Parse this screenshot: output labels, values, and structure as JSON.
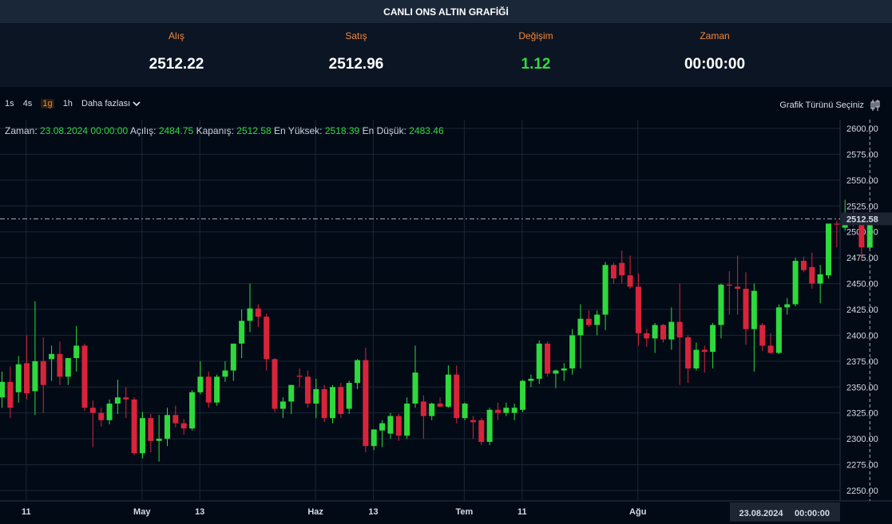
{
  "header": {
    "title": "CANLI ONS ALTIN GRAFİĞİ"
  },
  "stats": [
    {
      "label": "Alış",
      "value": "2512.22",
      "color": "#ffffff"
    },
    {
      "label": "Satış",
      "value": "2512.96",
      "color": "#ffffff"
    },
    {
      "label": "Değişim",
      "value": "1.12",
      "color": "#33d940"
    },
    {
      "label": "Zaman",
      "value": "00:00:00",
      "color": "#ffffff"
    }
  ],
  "toolbar": {
    "intervals": [
      "1s",
      "4s",
      "1g",
      "1h"
    ],
    "active_interval": "1g",
    "more_label": "Daha fazlası",
    "chart_type_label": "Grafik Türünü Seçiniz",
    "chart_type_icon": "candlestick-icon",
    "more_icon": "chevron-down-icon"
  },
  "ohlc_readout": {
    "time_label": "Zaman:",
    "time_value": "23.08.2024 00:00:00",
    "open_label": "Açılış:",
    "open_value": "2484.75",
    "close_label": "Kapanış:",
    "close_value": "2512.58",
    "high_label": "En Yüksek:",
    "high_value": "2518.39",
    "low_label": "En Düşük:",
    "low_value": "2483.46"
  },
  "crosshair": {
    "price_tag": "2512.58",
    "date_tag": "23.08.2024",
    "time_tag": "00:00:00"
  },
  "colors": {
    "up": "#2fd93c",
    "down": "#d8243b",
    "grid": "#1c2636",
    "crosshair": "#a8b2c0",
    "accent": "#f3883b"
  },
  "chart_data": {
    "type": "candlestick",
    "y_ticks": [
      2250,
      2275,
      2300,
      2325,
      2350,
      2375,
      2400,
      2425,
      2450,
      2475,
      2500,
      2525,
      2550,
      2575,
      2600
    ],
    "ylim": [
      2238,
      2608
    ],
    "x_ticks": [
      "11",
      "May",
      "13",
      "Haz",
      "13",
      "Tem",
      "11",
      "Ağu"
    ],
    "x_tick_index": [
      1,
      15,
      22,
      36,
      43,
      54,
      61,
      75
    ],
    "candles": [
      {
        "o": 2340,
        "h": 2365,
        "l": 2330,
        "c": 2355
      },
      {
        "o": 2355,
        "h": 2370,
        "l": 2320,
        "c": 2330
      },
      {
        "o": 2345,
        "h": 2380,
        "l": 2335,
        "c": 2372
      },
      {
        "o": 2373,
        "h": 2400,
        "l": 2338,
        "c": 2344
      },
      {
        "o": 2346,
        "h": 2433,
        "l": 2323,
        "c": 2375
      },
      {
        "o": 2375,
        "h": 2398,
        "l": 2325,
        "c": 2352
      },
      {
        "o": 2377,
        "h": 2390,
        "l": 2356,
        "c": 2382
      },
      {
        "o": 2382,
        "h": 2394,
        "l": 2352,
        "c": 2360
      },
      {
        "o": 2360,
        "h": 2375,
        "l": 2352,
        "c": 2378
      },
      {
        "o": 2378,
        "h": 2409,
        "l": 2365,
        "c": 2390
      },
      {
        "o": 2390,
        "h": 2392,
        "l": 2327,
        "c": 2330
      },
      {
        "o": 2330,
        "h": 2337,
        "l": 2292,
        "c": 2325
      },
      {
        "o": 2325,
        "h": 2330,
        "l": 2312,
        "c": 2318
      },
      {
        "o": 2318,
        "h": 2338,
        "l": 2314,
        "c": 2334
      },
      {
        "o": 2334,
        "h": 2357,
        "l": 2324,
        "c": 2340
      },
      {
        "o": 2340,
        "h": 2350,
        "l": 2320,
        "c": 2338
      },
      {
        "o": 2338,
        "h": 2340,
        "l": 2284,
        "c": 2286
      },
      {
        "o": 2286,
        "h": 2326,
        "l": 2281,
        "c": 2320
      },
      {
        "o": 2320,
        "h": 2324,
        "l": 2287,
        "c": 2298
      },
      {
        "o": 2298,
        "h": 2323,
        "l": 2278,
        "c": 2300
      },
      {
        "o": 2300,
        "h": 2330,
        "l": 2293,
        "c": 2323
      },
      {
        "o": 2323,
        "h": 2332,
        "l": 2311,
        "c": 2315
      },
      {
        "o": 2315,
        "h": 2319,
        "l": 2304,
        "c": 2310
      },
      {
        "o": 2310,
        "h": 2347,
        "l": 2308,
        "c": 2345
      },
      {
        "o": 2345,
        "h": 2375,
        "l": 2343,
        "c": 2360
      },
      {
        "o": 2360,
        "h": 2365,
        "l": 2330,
        "c": 2335
      },
      {
        "o": 2335,
        "h": 2362,
        "l": 2332,
        "c": 2360
      },
      {
        "o": 2360,
        "h": 2375,
        "l": 2355,
        "c": 2366
      },
      {
        "o": 2366,
        "h": 2386,
        "l": 2356,
        "c": 2392
      },
      {
        "o": 2392,
        "h": 2425,
        "l": 2378,
        "c": 2414
      },
      {
        "o": 2414,
        "h": 2450,
        "l": 2403,
        "c": 2426
      },
      {
        "o": 2426,
        "h": 2430,
        "l": 2408,
        "c": 2418
      },
      {
        "o": 2418,
        "h": 2421,
        "l": 2366,
        "c": 2377
      },
      {
        "o": 2377,
        "h": 2378,
        "l": 2326,
        "c": 2329
      },
      {
        "o": 2329,
        "h": 2340,
        "l": 2320,
        "c": 2336
      },
      {
        "o": 2336,
        "h": 2352,
        "l": 2324,
        "c": 2352
      },
      {
        "o": 2361,
        "h": 2368,
        "l": 2350,
        "c": 2360
      },
      {
        "o": 2360,
        "h": 2366,
        "l": 2330,
        "c": 2334
      },
      {
        "o": 2334,
        "h": 2358,
        "l": 2320,
        "c": 2348
      },
      {
        "o": 2348,
        "h": 2352,
        "l": 2316,
        "c": 2320
      },
      {
        "o": 2320,
        "h": 2352,
        "l": 2315,
        "c": 2350
      },
      {
        "o": 2350,
        "h": 2354,
        "l": 2320,
        "c": 2324
      },
      {
        "o": 2329,
        "h": 2356,
        "l": 2324,
        "c": 2354
      },
      {
        "o": 2354,
        "h": 2377,
        "l": 2348,
        "c": 2376
      },
      {
        "o": 2376,
        "h": 2388,
        "l": 2287,
        "c": 2293
      },
      {
        "o": 2293,
        "h": 2308,
        "l": 2289,
        "c": 2309
      },
      {
        "o": 2308,
        "h": 2318,
        "l": 2292,
        "c": 2315
      },
      {
        "o": 2305,
        "h": 2325,
        "l": 2300,
        "c": 2322
      },
      {
        "o": 2322,
        "h": 2324,
        "l": 2298,
        "c": 2303
      },
      {
        "o": 2303,
        "h": 2340,
        "l": 2300,
        "c": 2334
      },
      {
        "o": 2334,
        "h": 2390,
        "l": 2330,
        "c": 2364
      },
      {
        "o": 2336,
        "h": 2342,
        "l": 2300,
        "c": 2322
      },
      {
        "o": 2322,
        "h": 2335,
        "l": 2318,
        "c": 2334
      },
      {
        "o": 2334,
        "h": 2340,
        "l": 2332,
        "c": 2331
      },
      {
        "o": 2331,
        "h": 2371,
        "l": 2330,
        "c": 2362
      },
      {
        "o": 2362,
        "h": 2371,
        "l": 2315,
        "c": 2320
      },
      {
        "o": 2320,
        "h": 2335,
        "l": 2318,
        "c": 2334
      },
      {
        "o": 2318,
        "h": 2322,
        "l": 2300,
        "c": 2316
      },
      {
        "o": 2318,
        "h": 2320,
        "l": 2294,
        "c": 2297
      },
      {
        "o": 2297,
        "h": 2330,
        "l": 2294,
        "c": 2328
      },
      {
        "o": 2328,
        "h": 2335,
        "l": 2318,
        "c": 2325
      },
      {
        "o": 2325,
        "h": 2335,
        "l": 2322,
        "c": 2330
      },
      {
        "o": 2325,
        "h": 2334,
        "l": 2318,
        "c": 2330
      },
      {
        "o": 2328,
        "h": 2357,
        "l": 2326,
        "c": 2356
      },
      {
        "o": 2356,
        "h": 2362,
        "l": 2350,
        "c": 2358
      },
      {
        "o": 2358,
        "h": 2395,
        "l": 2353,
        "c": 2392
      },
      {
        "o": 2392,
        "h": 2394,
        "l": 2360,
        "c": 2363
      },
      {
        "o": 2363,
        "h": 2367,
        "l": 2349,
        "c": 2366
      },
      {
        "o": 2366,
        "h": 2373,
        "l": 2356,
        "c": 2368
      },
      {
        "o": 2368,
        "h": 2406,
        "l": 2362,
        "c": 2400
      },
      {
        "o": 2400,
        "h": 2430,
        "l": 2368,
        "c": 2416
      },
      {
        "o": 2416,
        "h": 2424,
        "l": 2408,
        "c": 2410
      },
      {
        "o": 2410,
        "h": 2424,
        "l": 2400,
        "c": 2420
      },
      {
        "o": 2420,
        "h": 2471,
        "l": 2405,
        "c": 2468
      },
      {
        "o": 2468,
        "h": 2470,
        "l": 2450,
        "c": 2455
      },
      {
        "o": 2470,
        "h": 2482,
        "l": 2450,
        "c": 2458
      },
      {
        "o": 2458,
        "h": 2477,
        "l": 2445,
        "c": 2447
      },
      {
        "o": 2447,
        "h": 2460,
        "l": 2390,
        "c": 2402
      },
      {
        "o": 2402,
        "h": 2406,
        "l": 2389,
        "c": 2397
      },
      {
        "o": 2397,
        "h": 2412,
        "l": 2383,
        "c": 2410
      },
      {
        "o": 2410,
        "h": 2411,
        "l": 2393,
        "c": 2396
      },
      {
        "o": 2396,
        "h": 2427,
        "l": 2386,
        "c": 2413
      },
      {
        "o": 2413,
        "h": 2450,
        "l": 2352,
        "c": 2398
      },
      {
        "o": 2398,
        "h": 2400,
        "l": 2354,
        "c": 2368
      },
      {
        "o": 2368,
        "h": 2393,
        "l": 2366,
        "c": 2386
      },
      {
        "o": 2386,
        "h": 2390,
        "l": 2364,
        "c": 2384
      },
      {
        "o": 2384,
        "h": 2412,
        "l": 2368,
        "c": 2410
      },
      {
        "o": 2410,
        "h": 2450,
        "l": 2397,
        "c": 2449
      },
      {
        "o": 2449,
        "h": 2462,
        "l": 2420,
        "c": 2448
      },
      {
        "o": 2447,
        "h": 2477,
        "l": 2420,
        "c": 2445
      },
      {
        "o": 2445,
        "h": 2461,
        "l": 2391,
        "c": 2406
      },
      {
        "o": 2406,
        "h": 2450,
        "l": 2365,
        "c": 2443
      },
      {
        "o": 2410,
        "h": 2412,
        "l": 2385,
        "c": 2390
      },
      {
        "o": 2390,
        "h": 2402,
        "l": 2382,
        "c": 2383
      },
      {
        "o": 2383,
        "h": 2430,
        "l": 2382,
        "c": 2427
      },
      {
        "o": 2427,
        "h": 2436,
        "l": 2420,
        "c": 2430
      },
      {
        "o": 2430,
        "h": 2475,
        "l": 2428,
        "c": 2472
      },
      {
        "o": 2472,
        "h": 2476,
        "l": 2461,
        "c": 2463
      },
      {
        "o": 2466,
        "h": 2480,
        "l": 2445,
        "c": 2450
      },
      {
        "o": 2450,
        "h": 2468,
        "l": 2431,
        "c": 2459
      },
      {
        "o": 2458,
        "h": 2500,
        "l": 2455,
        "c": 2508
      },
      {
        "o": 2508,
        "h": 2511,
        "l": 2485,
        "c": 2507
      },
      {
        "o": 2504,
        "h": 2531,
        "l": 2501,
        "c": 2514
      },
      {
        "o": 2514,
        "h": 2521,
        "l": 2505,
        "c": 2512
      },
      {
        "o": 2512,
        "h": 2514,
        "l": 2472,
        "c": 2485
      },
      {
        "o": 2484.75,
        "h": 2518.39,
        "l": 2483.46,
        "c": 2512.58
      }
    ]
  }
}
